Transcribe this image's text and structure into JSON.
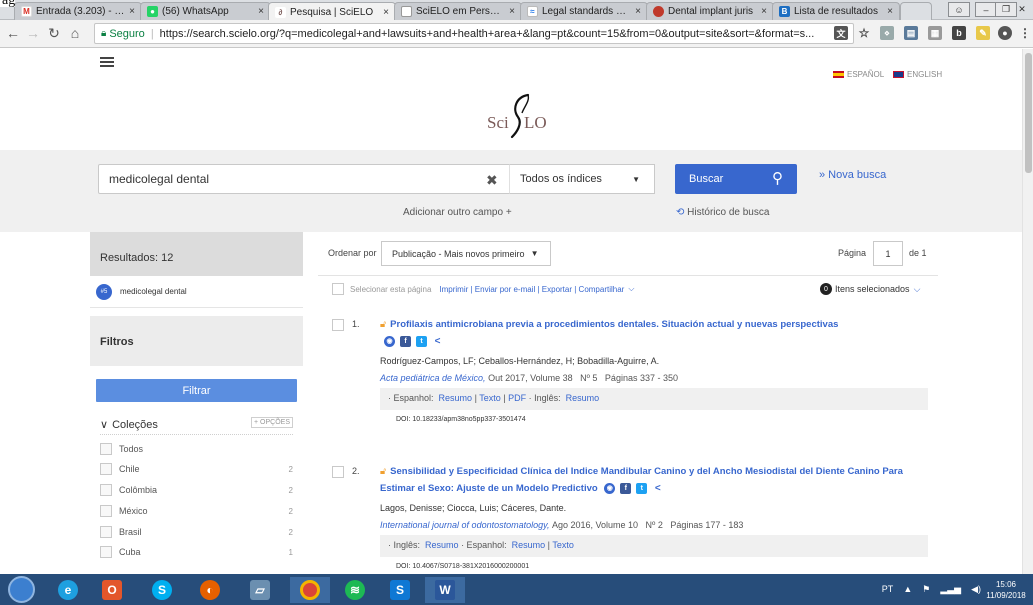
{
  "top_fragment": "ag",
  "browser": {
    "tabs": [
      {
        "label": "Entrada (3.203) - jf.s",
        "icon": "gmail",
        "active": false
      },
      {
        "label": "(56) WhatsApp",
        "icon": "whatsapp",
        "active": false
      },
      {
        "label": "Pesquisa | SciELO",
        "icon": "scielo",
        "active": true
      },
      {
        "label": "SciELO em Perspecti",
        "icon": "page",
        "active": false
      },
      {
        "label": "Legal standards of c",
        "icon": "paper",
        "active": false
      },
      {
        "label": "Dental implant juris",
        "icon": "dental",
        "active": false
      },
      {
        "label": "Lista de resultados",
        "icon": "bing",
        "active": false
      }
    ],
    "close_glyph": "×",
    "url_secure_label": "Seguro",
    "url": "https://search.scielo.org/?q=medicolegal+and+lawsuits+and+health+area+&lang=pt&count=15&from=0&output=site&sort=&format=s..."
  },
  "header": {
    "lang_es": "ESPAÑOL",
    "lang_en": "ENGLISH",
    "logo_left": "Sci",
    "logo_right": "LO"
  },
  "search": {
    "query": "medicolegal dental",
    "clear_glyph": "✖",
    "index_select": "Todos os índices",
    "button": "Buscar",
    "new_search": "» Nova busca",
    "add_field": "Adicionar outro campo +",
    "history": "Histórico de busca"
  },
  "sidebar": {
    "results_label": "Resultados: 12",
    "term_badge": "#5",
    "term": "medicolegal dental",
    "filters_label": "Filtros",
    "filter_button": "Filtrar",
    "collections_label": "Coleções",
    "options": "+ OPÇÕES",
    "collections": [
      {
        "name": "Todos",
        "count": ""
      },
      {
        "name": "Chile",
        "count": "2"
      },
      {
        "name": "Colômbia",
        "count": "2"
      },
      {
        "name": "México",
        "count": "2"
      },
      {
        "name": "Brasil",
        "count": "2"
      },
      {
        "name": "Cuba",
        "count": "1"
      }
    ]
  },
  "results_bar": {
    "sort_label": "Ordenar por",
    "sort_value": "Publicação - Mais novos primeiro",
    "page_label": "Página",
    "page_value": "1",
    "page_of": "de 1",
    "select_page": "Selecionar esta página",
    "actions": "Imprimir | Enviar por e-mail | Exportar | Compartilhar",
    "selected_count": "0",
    "selected_label": "Itens selecionados"
  },
  "results": [
    {
      "num": "1.",
      "title": "Profilaxis antimicrobiana previa a procedimientos dentales. Situación actual y nuevas perspectivas",
      "authors": "Rodríguez-Campos, LF; Ceballos-Hernández, H; Bobadilla-Aguirre, A.",
      "journal": "Acta pediátrica de México,",
      "meta": "Out 2017, Volume 38   Nº 5   Páginas 337 - 350",
      "links_pre": "· Espanhol: ",
      "links_a": "Resumo",
      "links_b": "Texto",
      "links_c": "PDF",
      "links_mid": "· Inglês: ",
      "links_d": "Resumo",
      "doi": "DOI: 10.18233/apm38no5pp337-3501474"
    },
    {
      "num": "2.",
      "title": "Sensibilidad y Especificidad Clínica del Indice Mandibular Canino y del Ancho Mesiodistal del Diente Canino Para Estimar el Sexo: Ajuste de un Modelo Predictivo",
      "authors": "Lagos, Denisse; Ciocca, Luis; Cáceres, Dante.",
      "journal": "International journal of odontostomatology,",
      "meta": "Ago 2016, Volume 10   Nº 2   Páginas 177 - 183",
      "links_pre": "· Inglês: ",
      "links_a": "Resumo",
      "links_mid": "· Espanhol: ",
      "links_b": "Resumo",
      "links_c": "Texto",
      "doi": "DOI: 10.4067/S0718-381X2016000200001"
    }
  ],
  "taskbar": {
    "lang": "PT",
    "time": "15:06",
    "date": "11/09/2018"
  }
}
